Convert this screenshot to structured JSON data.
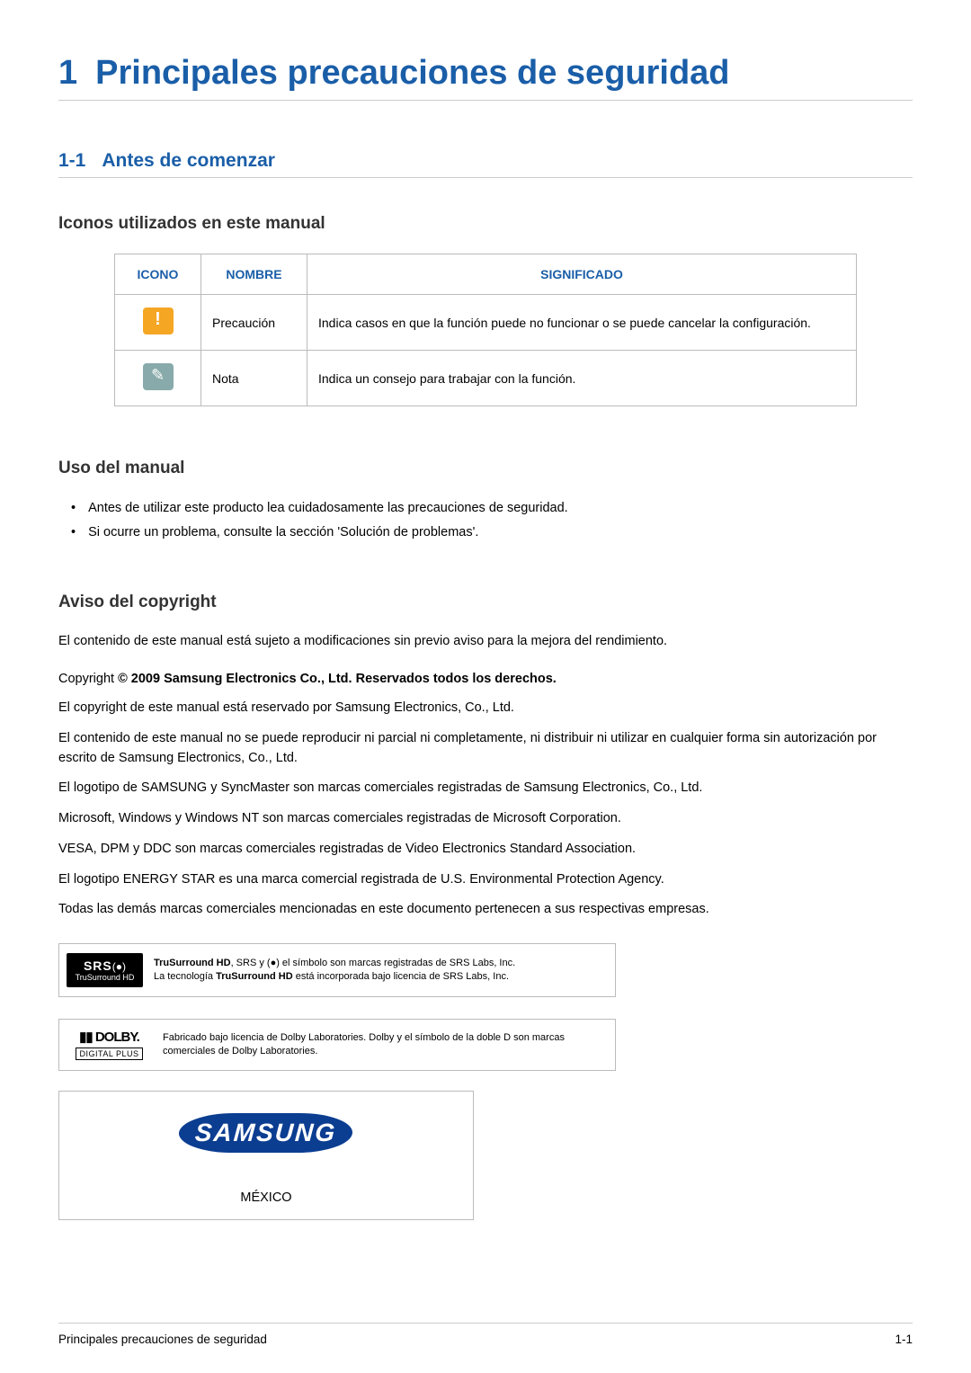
{
  "chapter": {
    "number": "1",
    "title": "Principales precauciones de seguridad"
  },
  "section": {
    "number": "1-1",
    "title": "Antes de comenzar"
  },
  "icons_heading": "Iconos utilizados en este manual",
  "table": {
    "headers": {
      "icon": "ICONO",
      "name": "NOMBRE",
      "meaning": "SIGNIFICADO"
    },
    "rows": [
      {
        "name": "Precaución",
        "meaning": "Indica casos en que la función puede no funcionar o se puede cancelar la configuración."
      },
      {
        "name": "Nota",
        "meaning": "Indica un consejo para trabajar con la función."
      }
    ]
  },
  "usage": {
    "heading": "Uso del manual",
    "bullets": [
      "Antes de utilizar este producto lea cuidadosamente las precauciones de seguridad.",
      "Si ocurre un problema, consulte la sección 'Solución de problemas'."
    ]
  },
  "copyright": {
    "heading": "Aviso del copyright",
    "intro": "El contenido de este manual está sujeto a modificaciones sin previo aviso para la mejora del rendimiento.",
    "line_prefix": "Copyright ",
    "line_bold": "© 2009 Samsung Electronics Co., Ltd. Reservados todos los derechos.",
    "paras": [
      "El copyright de este manual está reservado por Samsung Electronics, Co., Ltd.",
      "El contenido de este manual no se puede reproducir ni parcial ni completamente, ni distribuir ni utilizar en cualquier forma sin autorización por escrito de Samsung Electronics, Co., Ltd.",
      "El logotipo de SAMSUNG y SyncMaster son marcas comerciales registradas de Samsung Electronics, Co., Ltd.",
      "Microsoft, Windows y Windows NT son marcas comerciales registradas de Microsoft Corporation.",
      "VESA, DPM y DDC son marcas comerciales registradas de Video Electronics Standard Association.",
      "El logotipo ENERGY STAR es una marca comercial registrada de U.S. Environmental Protection Agency.",
      "Todas las demás marcas comerciales mencionadas en este documento pertenecen a sus respectivas empresas."
    ]
  },
  "srs": {
    "logo_big": "SRS",
    "logo_circ": "(●)",
    "logo_sub": "TruSurround HD",
    "text_a": "TruSurround HD",
    "text_b": ", SRS y (●) el símbolo son marcas registradas de SRS Labs, Inc.",
    "text_c": "La tecnología ",
    "text_d": "TruSurround HD",
    "text_e": " está incorporada bajo licencia de SRS Labs, Inc."
  },
  "dolby": {
    "logo_dd": "▮▮ DOLBY.",
    "logo_plus": "DIGITAL PLUS",
    "text": "Fabricado bajo licencia de Dolby Laboratories. Dolby y el símbolo de la doble D son marcas comerciales de Dolby Laboratories."
  },
  "samsung": {
    "logo": "SAMSUNG",
    "country": "MÉXICO"
  },
  "footer": {
    "left": "Principales precauciones de seguridad",
    "right": "1-1"
  }
}
